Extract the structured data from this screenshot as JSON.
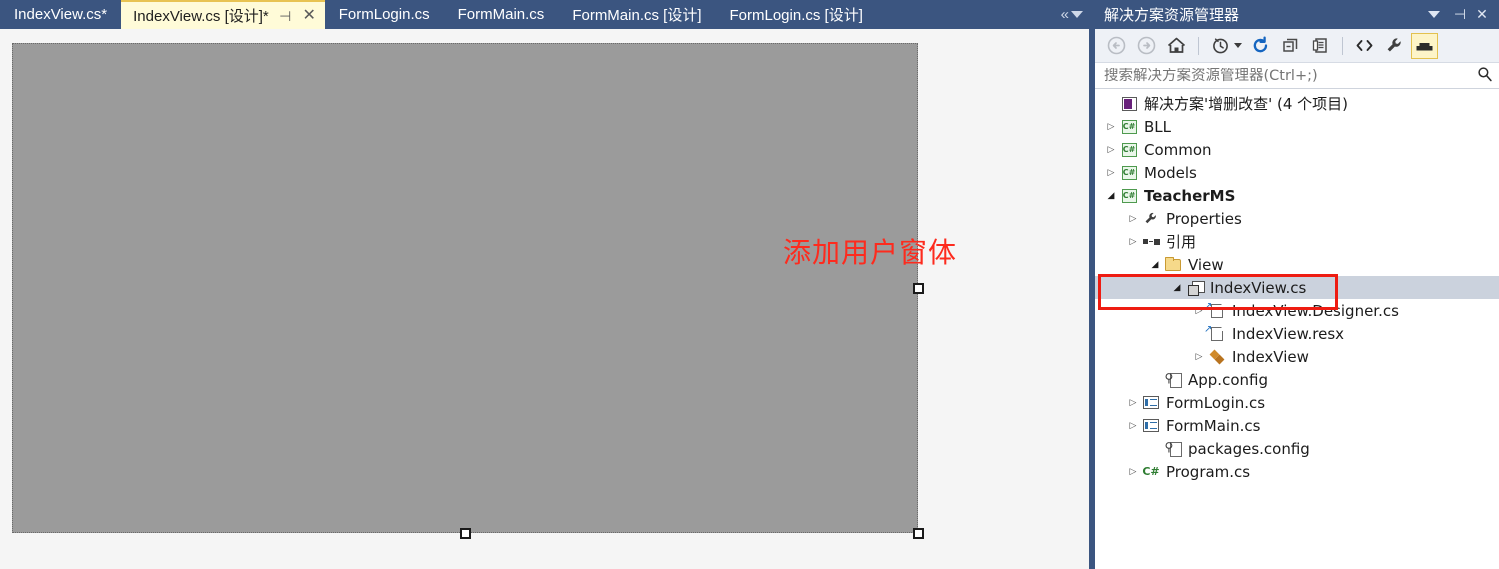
{
  "editor": {
    "tabs": [
      {
        "label": "IndexView.cs*",
        "active": false
      },
      {
        "label": "IndexView.cs [设计]*",
        "active": true,
        "pin": "⊣",
        "close": "✕"
      },
      {
        "label": "FormLogin.cs",
        "active": false
      },
      {
        "label": "FormMain.cs",
        "active": false
      },
      {
        "label": "FormMain.cs [设计]",
        "active": false
      },
      {
        "label": "FormLogin.cs [设计]",
        "active": false
      }
    ],
    "overflow_chevron": "«",
    "overflow_dropdown": "dropdown-caret"
  },
  "designer": {
    "form_caption": "添加用户窗体",
    "caption_color": "#fd2b1e",
    "form_background": "#9b9b9b",
    "surface_background": "#f5f5f5"
  },
  "solution_explorer": {
    "title": "解决方案资源管理器",
    "title_caret": "dropdown-caret",
    "pin": "⊣",
    "close": "✕",
    "toolbar": [
      {
        "name": "back-icon",
        "glyph": "←"
      },
      {
        "name": "forward-icon",
        "glyph": "→"
      },
      {
        "name": "home-icon",
        "glyph": "⌂"
      },
      {
        "name": "pending-changes-icon",
        "glyph": "◷"
      },
      {
        "name": "refresh-icon",
        "glyph": "↻"
      },
      {
        "name": "collapse-all-icon",
        "glyph": "▭"
      },
      {
        "name": "properties-icon",
        "glyph": "▤"
      },
      {
        "name": "show-all-files-icon",
        "glyph": "<>"
      },
      {
        "name": "wrench-icon",
        "glyph": "🔧"
      },
      {
        "name": "preview-selected-items-icon",
        "glyph": "▬",
        "selected": true
      }
    ],
    "search": {
      "placeholder": "搜索解决方案资源管理器(Ctrl+;)",
      "value": "",
      "icon": "search-icon"
    },
    "tree": [
      {
        "label": "解决方案'增删改查' (4 个项目)",
        "indent": 0,
        "twist": "none",
        "icon": "solution-icon",
        "bold": false,
        "selected": false
      },
      {
        "label": "BLL",
        "indent": 1,
        "twist": "closed",
        "icon": "csharp-project-icon",
        "bold": false,
        "selected": false
      },
      {
        "label": "Common",
        "indent": 1,
        "twist": "closed",
        "icon": "csharp-project-icon",
        "bold": false,
        "selected": false
      },
      {
        "label": "Models",
        "indent": 1,
        "twist": "closed",
        "icon": "csharp-project-icon",
        "bold": false,
        "selected": false
      },
      {
        "label": "TeacherMS",
        "indent": 1,
        "twist": "open",
        "icon": "csharp-project-icon",
        "bold": true,
        "selected": false
      },
      {
        "label": "Properties",
        "indent": 2,
        "twist": "closed",
        "icon": "wrench-icon",
        "bold": false,
        "selected": false
      },
      {
        "label": "引用",
        "indent": 2,
        "twist": "closed",
        "icon": "references-icon",
        "bold": false,
        "selected": false
      },
      {
        "label": "View",
        "indent": 2,
        "twist": "open",
        "icon": "folder-icon",
        "bold": false,
        "selected": false
      },
      {
        "label": "IndexView.cs",
        "indent": 3,
        "twist": "open",
        "icon": "winform-icon",
        "bold": false,
        "selected": true
      },
      {
        "label": "IndexView.Designer.cs",
        "indent": 4,
        "twist": "closed",
        "icon": "designer-file-icon",
        "bold": false,
        "selected": false
      },
      {
        "label": "IndexView.resx",
        "indent": 4,
        "twist": "none",
        "icon": "resx-file-icon",
        "bold": false,
        "selected": false
      },
      {
        "label": "IndexView",
        "indent": 4,
        "twist": "closed",
        "icon": "component-icon",
        "bold": false,
        "selected": false
      },
      {
        "label": "App.config",
        "indent": 2,
        "twist": "none",
        "icon": "config-icon",
        "bold": false,
        "selected": false
      },
      {
        "label": "FormLogin.cs",
        "indent": 2,
        "twist": "closed",
        "icon": "form-list-icon",
        "bold": false,
        "selected": false
      },
      {
        "label": "FormMain.cs",
        "indent": 2,
        "twist": "closed",
        "icon": "form-list-icon",
        "bold": false,
        "selected": false
      },
      {
        "label": "packages.config",
        "indent": 2,
        "twist": "none",
        "icon": "config-icon",
        "bold": false,
        "selected": false
      },
      {
        "label": "Program.cs",
        "indent": 2,
        "twist": "closed",
        "icon": "csharp-file-icon",
        "bold": false,
        "selected": false
      }
    ]
  },
  "annotation": {
    "highlight_color": "#ee1c12",
    "target": "IndexView.cs"
  }
}
